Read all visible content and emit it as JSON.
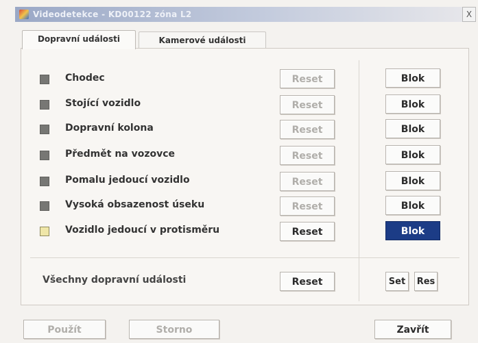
{
  "window": {
    "title": "Videodetekce - KD00122 zóna L2",
    "close_glyph": "X"
  },
  "tabs": [
    {
      "label": "Dopravní události",
      "active": true
    },
    {
      "label": "Kamerové události",
      "active": false
    }
  ],
  "events": [
    {
      "label": "Chodec",
      "indicator": "gray",
      "reset_label": "Reset",
      "reset_enabled": false,
      "blok_label": "Blok",
      "blok_active": false
    },
    {
      "label": "Stojící vozidlo",
      "indicator": "gray",
      "reset_label": "Reset",
      "reset_enabled": false,
      "blok_label": "Blok",
      "blok_active": false
    },
    {
      "label": "Dopravní kolona",
      "indicator": "gray",
      "reset_label": "Reset",
      "reset_enabled": false,
      "blok_label": "Blok",
      "blok_active": false
    },
    {
      "label": "Předmět na vozovce",
      "indicator": "gray",
      "reset_label": "Reset",
      "reset_enabled": false,
      "blok_label": "Blok",
      "blok_active": false
    },
    {
      "label": "Pomalu jedoucí vozidlo",
      "indicator": "gray",
      "reset_label": "Reset",
      "reset_enabled": false,
      "blok_label": "Blok",
      "blok_active": false
    },
    {
      "label": "Vysoká obsazenost úseku",
      "indicator": "gray",
      "reset_label": "Reset",
      "reset_enabled": false,
      "blok_label": "Blok",
      "blok_active": false
    },
    {
      "label": "Vozidlo jedoucí v protisměru",
      "indicator": "yellow",
      "reset_label": "Reset",
      "reset_enabled": true,
      "blok_label": "Blok",
      "blok_active": true
    }
  ],
  "all_events": {
    "label": "Všechny dopravní události",
    "reset_label": "Reset",
    "set_label": "Set",
    "res_label": "Res"
  },
  "footer": {
    "apply_label": "Použít",
    "cancel_label": "Storno",
    "close_label": "Zavřít"
  },
  "colors": {
    "indicator_gray": "#777774",
    "indicator_yellow": "#efe6a8",
    "selected_button": "#1c3c86"
  }
}
